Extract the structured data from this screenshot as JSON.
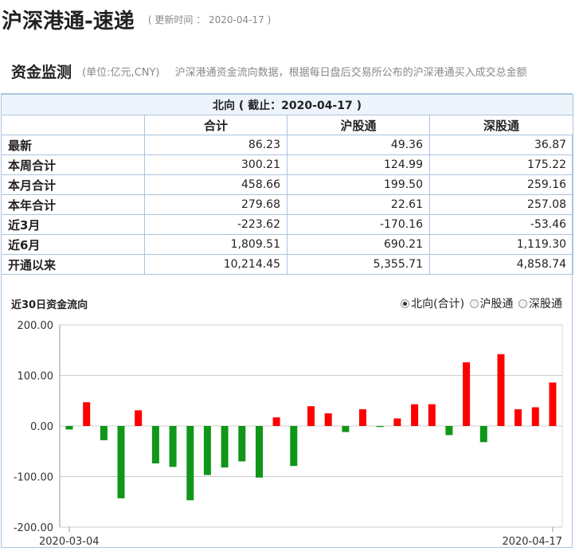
{
  "header": {
    "title": "沪深港通-速递",
    "update_text": "( 更新时间 ： 2020-04-17 )"
  },
  "section": {
    "title": "资金监测",
    "unit": "(单位:亿元,CNY)",
    "description": "沪深港通资金流向数据，根据每日盘后交易所公布的沪深港通买入成交总金额"
  },
  "table": {
    "caption": "北向 ( 截止：2020-04-17 )",
    "columns": [
      "合计",
      "沪股通",
      "深股通"
    ],
    "rows": [
      {
        "label": "最新",
        "values": [
          "86.23",
          "49.36",
          "36.87"
        ]
      },
      {
        "label": "本周合计",
        "values": [
          "300.21",
          "124.99",
          "175.22"
        ]
      },
      {
        "label": "本月合计",
        "values": [
          "458.66",
          "199.50",
          "259.16"
        ]
      },
      {
        "label": "本年合计",
        "values": [
          "279.68",
          "22.61",
          "257.08"
        ]
      },
      {
        "label": "近3月",
        "values": [
          "-223.62",
          "-170.16",
          "-53.46"
        ]
      },
      {
        "label": "近6月",
        "values": [
          "1,809.51",
          "690.21",
          "1,119.30"
        ]
      },
      {
        "label": "开通以来",
        "values": [
          "10,214.45",
          "5,355.71",
          "4,858.74"
        ]
      }
    ]
  },
  "chart_section": {
    "title": "近30日资金流向",
    "options": [
      {
        "label": "北向(合计)",
        "selected": true
      },
      {
        "label": "沪股通",
        "selected": false
      },
      {
        "label": "深股通",
        "selected": false
      }
    ]
  },
  "colors": {
    "positive": "#ff0000",
    "negative": "#109618",
    "grid": "#cccccc",
    "table_border": "#a9c4e0",
    "caption_bg": "#eef4fb"
  },
  "chart_data": {
    "type": "bar",
    "title": "",
    "xlabel": "",
    "ylabel": "",
    "ylim": [
      -200,
      200
    ],
    "y_ticks": [
      "200.00",
      "100.00",
      "0.00",
      "-100.00",
      "-200.00"
    ],
    "x_tick_labels": [
      "2020-03-04",
      "2020-04-17"
    ],
    "grid": true,
    "series": [
      {
        "values": [
          -7,
          47,
          -28,
          -143,
          31,
          -74,
          -81,
          -147,
          -97,
          -82,
          -70,
          -102,
          17,
          -79,
          39,
          25,
          -12,
          33,
          -2,
          15,
          43,
          43,
          -18,
          126,
          -32,
          142,
          33,
          37,
          86
        ]
      }
    ]
  }
}
